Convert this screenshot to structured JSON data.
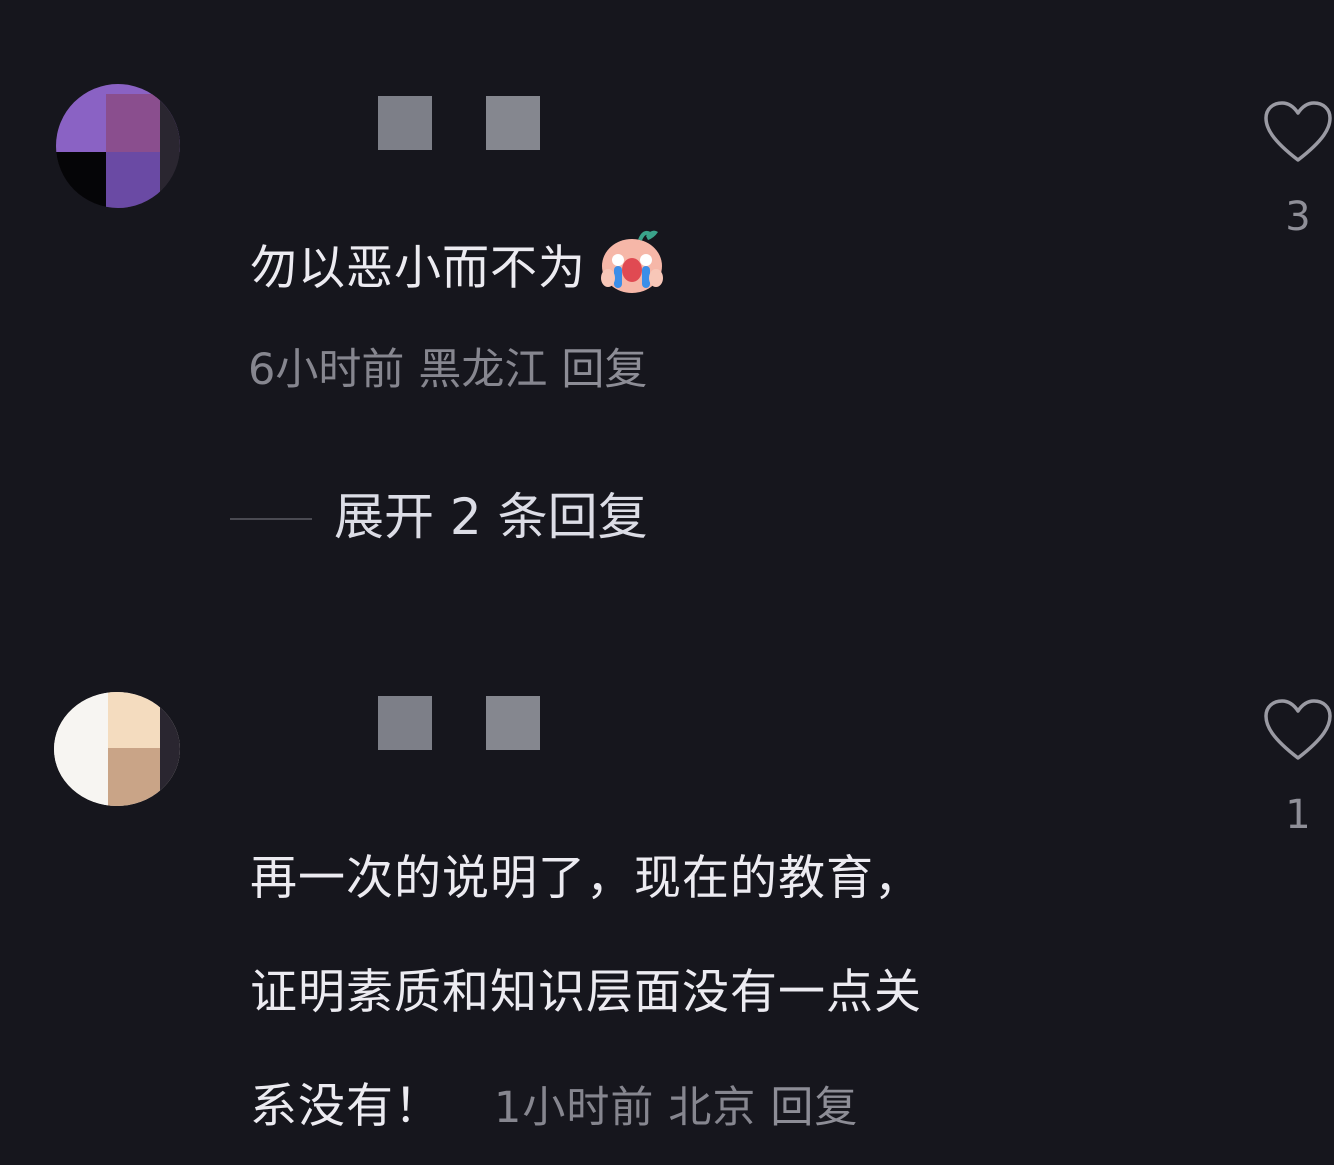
{
  "comments": [
    {
      "text_lines": [
        "勿以恶小而不为"
      ],
      "emoji": "crying-face-emoji",
      "time": "6小时前",
      "location": "黑龙江",
      "reply_label": "回复",
      "expand_label": "展开 2 条回复",
      "like_count": "3"
    },
    {
      "text_lines": [
        "再一次的说明了，现在的教育，",
        "证明素质和知识层面没有一点关",
        "系没有！"
      ],
      "time": "1小时前",
      "location": "北京",
      "reply_label": "回复",
      "like_count": "1"
    }
  ],
  "icons": {
    "like": "heart-outline-icon"
  },
  "colors": {
    "background": "#16161d",
    "text": "#ecebf1",
    "meta": "#86868f"
  }
}
